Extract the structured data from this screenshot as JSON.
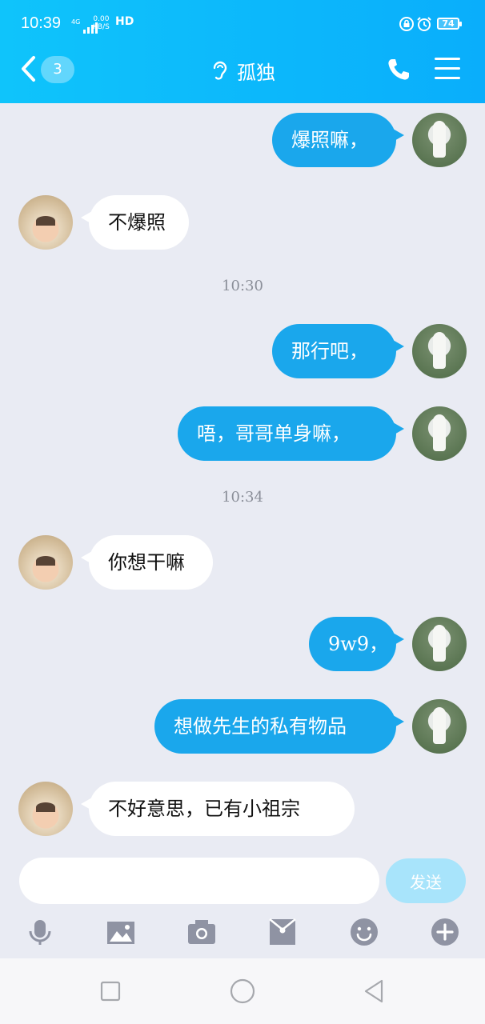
{
  "status_bar": {
    "time": "10:39",
    "network_type": "4G",
    "speed_value": "0.00",
    "speed_unit": "KB/S",
    "hd_label": "HD",
    "battery": "74"
  },
  "header": {
    "back_badge": "3",
    "title": "孤独",
    "icons": [
      "chevron-left-icon",
      "ear-icon",
      "phone-icon",
      "menu-icon"
    ],
    "gradient_colors": [
      "#0fc4fb",
      "#0aaefb"
    ]
  },
  "messages": [
    {
      "side": "right",
      "text": "爆照嘛，"
    },
    {
      "side": "left",
      "text": "不爆照"
    },
    {
      "type": "timestamp",
      "text": "10:30"
    },
    {
      "side": "right",
      "text": "那行吧，"
    },
    {
      "side": "right",
      "text": "唔，哥哥单身嘛，"
    },
    {
      "type": "timestamp",
      "text": "10:34"
    },
    {
      "side": "left",
      "text": "你想干嘛"
    },
    {
      "side": "right",
      "text": "9w9，"
    },
    {
      "side": "right",
      "text": "想做先生的私有物品"
    },
    {
      "side": "left",
      "text": "不好意思，已有小祖宗"
    }
  ],
  "composer": {
    "input_value": "",
    "send_label": "发送"
  },
  "toolbar_icons": [
    "microphone-icon",
    "image-icon",
    "camera-icon",
    "red-packet-icon",
    "emoji-icon",
    "plus-icon"
  ],
  "colors": {
    "outgoing_bubble": "#1aa7ec",
    "incoming_bubble": "#ffffff",
    "chat_background": "#e9ebf3",
    "send_button": "#a8e4fb"
  }
}
